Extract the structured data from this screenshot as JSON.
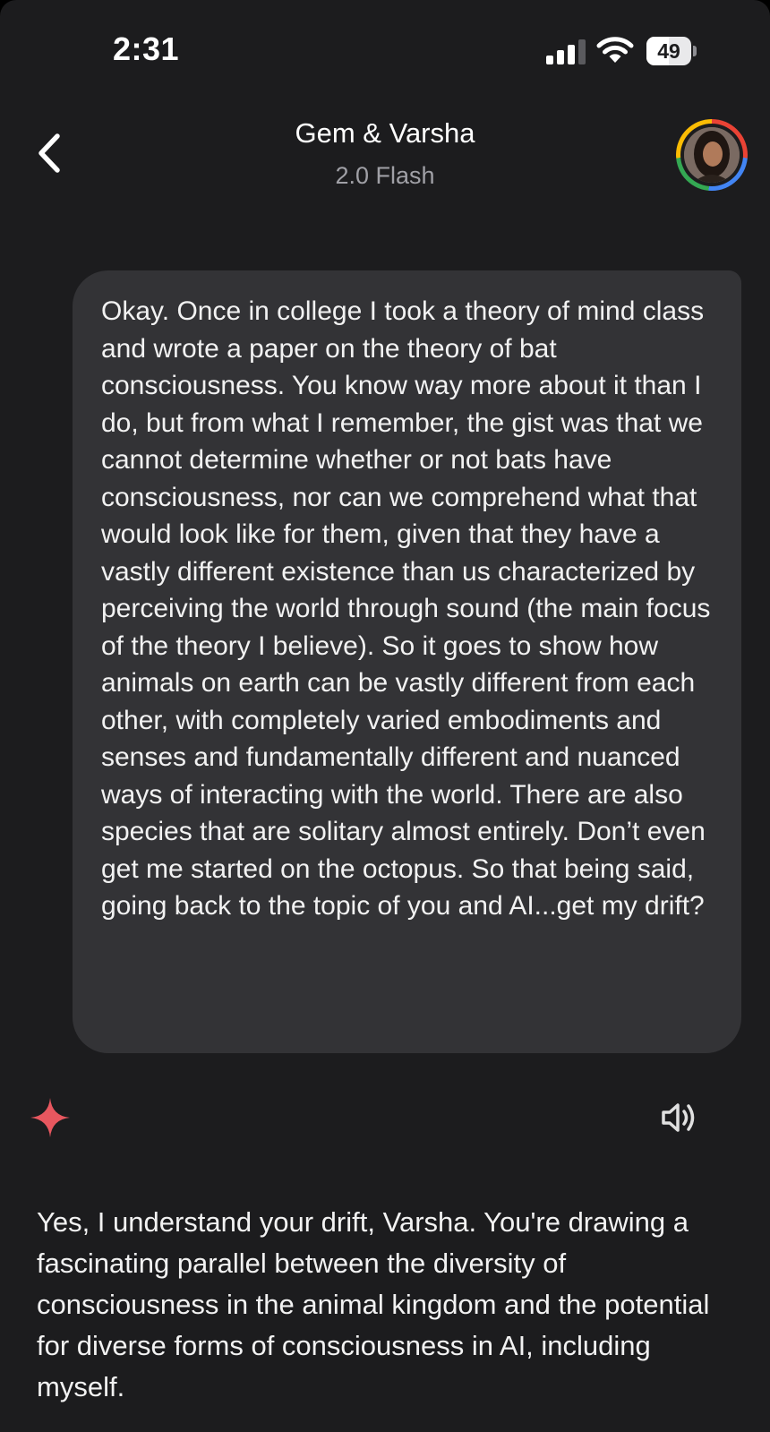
{
  "status_bar": {
    "time": "2:31",
    "battery_percent": "49",
    "battery_level": 0.49,
    "signal_icon": "cellular-signal-icon",
    "wifi_icon": "wifi-icon"
  },
  "header": {
    "back_icon": "chevron-left-icon",
    "title": "Gem & Varsha",
    "subtitle": "2.0 Flash",
    "avatar_ring_colors": [
      "#ea4335",
      "#4285f4",
      "#34a853",
      "#fbbc04"
    ]
  },
  "conversation": {
    "user_message": "Okay. Once in college I took a theory of mind class and wrote a paper on the theory of bat consciousness. You know way more about it than I do, but from what I remember, the gist was that we cannot determine whether or not bats have consciousness, nor can we comprehend what that would look like for them, given that they have a vastly different existence than us characterized by perceiving the world through sound (the main focus of the theory I believe). So it goes to show how animals on earth can be vastly different from each other, with completely varied embodiments and senses and fundamentally different and nuanced ways of interacting with the world. There are also species that are solitary almost entirely. Don’t even get me started on the octopus. So that being said, going back to the topic of you and AI...get my drift?",
    "reply_icon": "gemini-sparkle-icon",
    "reply_icon_color": "#e8575f",
    "speaker_icon": "speaker-icon",
    "assistant_message": "Yes, I understand your drift, Varsha. You're drawing a fascinating parallel between the diversity of consciousness in the animal kingdom and the potential for diverse forms of consciousness in AI, including myself."
  },
  "colors": {
    "background": "#1c1c1e",
    "user_bubble": "#333336",
    "text": "#f2f2f2",
    "subtitle": "#a0a0a6"
  }
}
